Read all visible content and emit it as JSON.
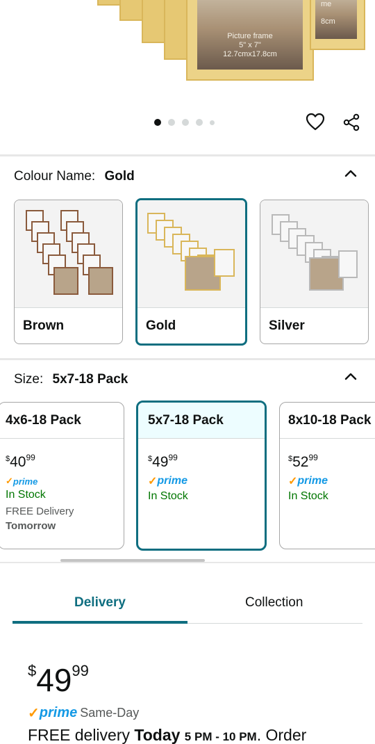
{
  "hero": {
    "photo_main": {
      "line1": "Picture frame",
      "line2": "5\" x 7\"",
      "line3": "12.7cmx17.8cm"
    },
    "photo_right": {
      "line1": "me",
      "line2": "8cm"
    },
    "carousel_dots": 5,
    "carousel_active": 0,
    "icons": {
      "wishlist": "heart-outline-icon",
      "share": "share-icon"
    }
  },
  "colour": {
    "label": "Colour Name:",
    "value": "Gold",
    "options": [
      {
        "name": "Brown",
        "selected": false,
        "frame_color": "#8a5a3c"
      },
      {
        "name": "Gold",
        "selected": true,
        "frame_color": "#d9b65a"
      },
      {
        "name": "Silver",
        "selected": false,
        "frame_color": "#b9b9b9"
      }
    ]
  },
  "size": {
    "label": "Size:",
    "value": "5x7-18 Pack",
    "options": [
      {
        "name": "4x6-18 Pack",
        "symbol": "$",
        "whole": "40",
        "cents": "99",
        "prime": "prime",
        "stock": "In Stock",
        "delivery": "FREE Delivery",
        "delivery_day": "Tomorrow",
        "selected": false
      },
      {
        "name": "5x7-18 Pack",
        "symbol": "$",
        "whole": "49",
        "cents": "99",
        "prime": "prime",
        "stock": "In Stock",
        "selected": true
      },
      {
        "name": "8x10-18 Pack",
        "symbol": "$",
        "whole": "52",
        "cents": "99",
        "prime": "prime",
        "stock": "In Stock",
        "selected": false
      }
    ]
  },
  "tabs": {
    "delivery": "Delivery",
    "collection": "Collection",
    "active": "Delivery"
  },
  "buybox": {
    "symbol": "$",
    "whole": "49",
    "cents": "99",
    "prime": "prime",
    "same_day": "Same-Day",
    "delivery_prefix": "FREE delivery",
    "delivery_day": "Today",
    "delivery_window": "5 PM - 10 PM",
    "delivery_suffix": ". Order"
  },
  "colors": {
    "accent": "#0f6e80",
    "prime_blue": "#1399e5",
    "prime_check": "#ff9900",
    "in_stock": "#007600"
  }
}
